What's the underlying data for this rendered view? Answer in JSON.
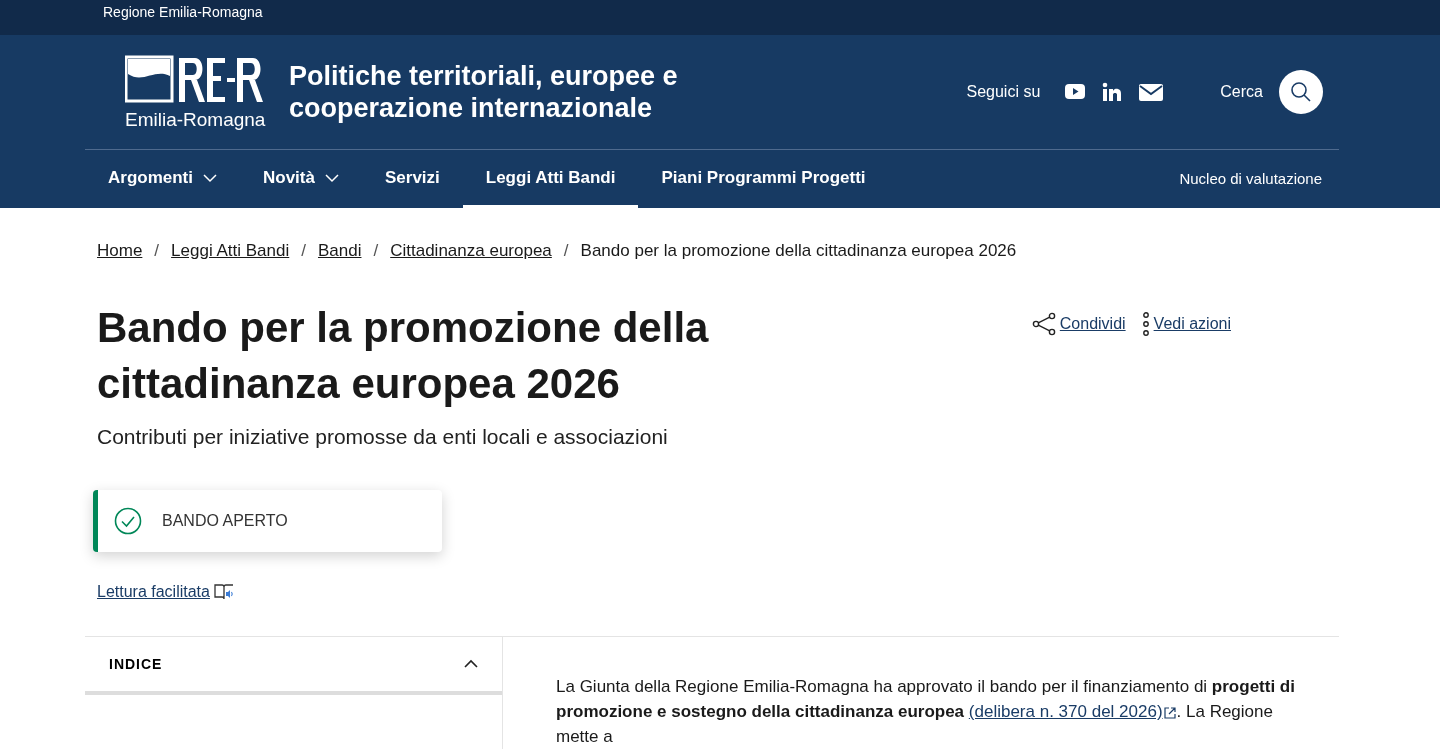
{
  "top_bar": {
    "label": "Regione Emilia-Romagna"
  },
  "header": {
    "logo_text": "Emilia-Romagna",
    "title": "Politiche territoriali, europee e cooperazione internazionale",
    "social_label": "Seguici su",
    "social": [
      {
        "kind": "youtube"
      },
      {
        "kind": "linkedin"
      },
      {
        "kind": "mail"
      }
    ],
    "search_label": "Cerca"
  },
  "nav": {
    "items": [
      {
        "label": "Argomenti",
        "dropdown": true,
        "selected": false
      },
      {
        "label": "Novità",
        "dropdown": true,
        "selected": false
      },
      {
        "label": "Servizi",
        "dropdown": false,
        "selected": false
      },
      {
        "label": "Leggi Atti Bandi",
        "dropdown": false,
        "selected": true
      },
      {
        "label": "Piani Programmi Progetti",
        "dropdown": false,
        "selected": false
      }
    ],
    "right_link": "Nucleo di valutazione"
  },
  "breadcrumb": [
    {
      "label": "Home",
      "link": true
    },
    {
      "separator": "/",
      "label": "Leggi Atti Bandi",
      "link": true
    },
    {
      "separator": "/",
      "label": "Bandi",
      "link": true
    },
    {
      "separator": "/",
      "label": "Cittadinanza europea",
      "link": true
    },
    {
      "separator": "/",
      "label": "Bando per la promozione della cittadinanza europea 2026",
      "link": false
    }
  ],
  "page": {
    "title": "Bando per la promozione della cittadinanza europea 2026",
    "subtitle": "Contributi per iniziative promosse da enti locali e associazioni",
    "actions": [
      {
        "kind": "share",
        "label": "Condividi"
      },
      {
        "kind": "more",
        "label": "Vedi azioni"
      }
    ],
    "status": {
      "label": "BANDO APERTO",
      "color": "#008758"
    },
    "easy_read": "Lettura facilitata"
  },
  "index": {
    "title": "INDICE",
    "expanded": true
  },
  "body": {
    "text_before": "La Giunta della Regione Emilia-Romagna ha approvato il bando per il finanziamento di **progetti di promozione e sostegno della cittadinanza europea**",
    "link": "(delibera n. 370 del 2026)",
    "text_after": ". La Regione mette a"
  }
}
